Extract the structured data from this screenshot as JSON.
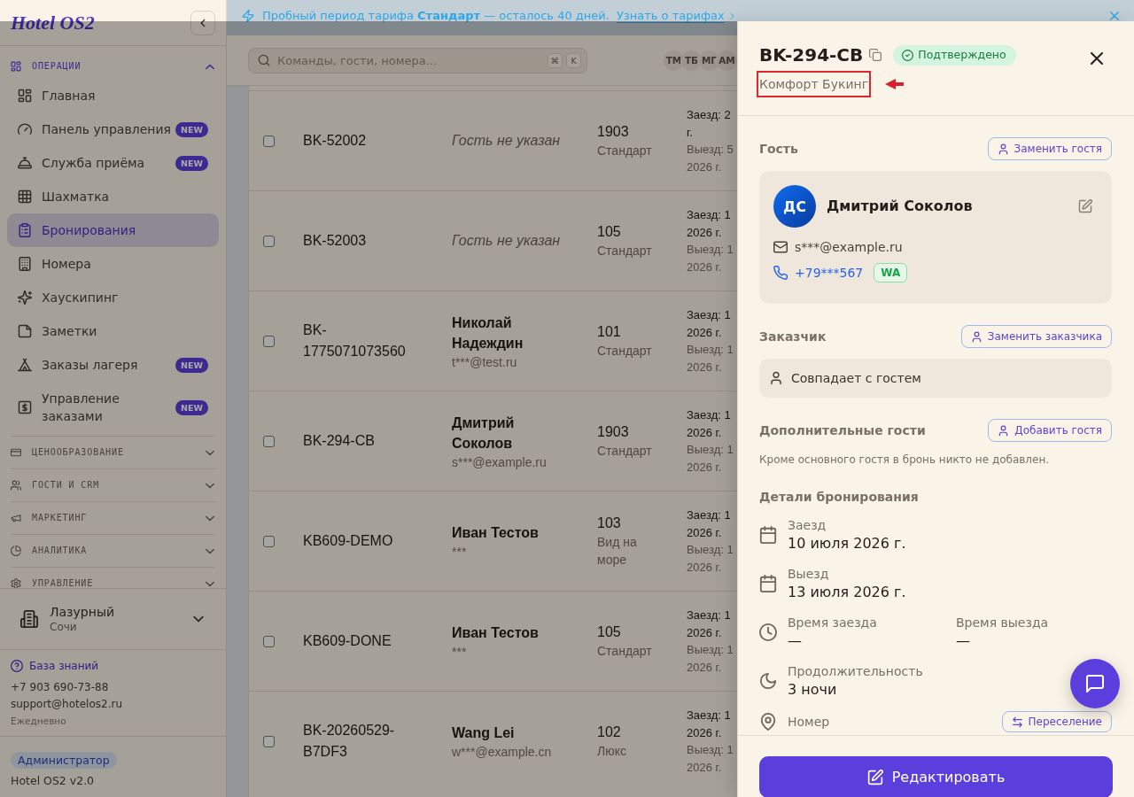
{
  "sidebar": {
    "logo": "Hotel OS2",
    "sections": [
      {
        "label": "ОПЕРАЦИИ",
        "expanded": true,
        "items": [
          {
            "label": "Главная",
            "selected": false
          },
          {
            "label": "Панель управления",
            "badge": "NEW",
            "selected": false
          },
          {
            "label": "Служба приёма",
            "badge": "NEW",
            "selected": false
          },
          {
            "label": "Шахматка",
            "selected": false
          },
          {
            "label": "Бронирования",
            "selected": true
          },
          {
            "label": "Номера",
            "selected": false
          },
          {
            "label": "Хаускипинг",
            "selected": false
          },
          {
            "label": "Заметки",
            "selected": false
          },
          {
            "label": "Заказы лагеря",
            "badge": "NEW",
            "selected": false
          },
          {
            "label": "Управление заказами",
            "badge": "NEW",
            "selected": false
          }
        ]
      },
      {
        "label": "ЦЕНООБРАЗОВАНИЕ",
        "expanded": false
      },
      {
        "label": "ГОСТИ И CRM",
        "expanded": false
      },
      {
        "label": "МАРКЕТИНГ",
        "expanded": false
      },
      {
        "label": "АНАЛИТИКА",
        "expanded": false
      },
      {
        "label": "УПРАВЛЕНИЕ",
        "expanded": false
      }
    ],
    "property": {
      "name": "Лазурный",
      "city": "Сочи"
    },
    "support": {
      "link": "База знаний",
      "phone": "+7 903 690-73-88",
      "email": "support@hotelos2.ru",
      "hours": "Ежедневно"
    },
    "user": {
      "role": "Администратор",
      "version": "Hotel OS2 v2.0"
    }
  },
  "banner": {
    "text": "Пробный период тарифа **Стандарт** — осталось 40 дней.",
    "link": "Узнать о тарифах"
  },
  "header": {
    "search": {
      "placeholder": "Команды, гости, номера...",
      "shortcut": [
        "⌘",
        "K"
      ]
    },
    "team": [
      "ТМ",
      "ТБ",
      "МГ",
      "АМ"
    ]
  },
  "bookings": {
    "rows": [
      {
        "checked": false,
        "id": "BK-52002",
        "guest": {
          "name": "Гость не указан",
          "unknown": true
        },
        "room": "1903",
        "room_type": "Стандарт",
        "checkin": [
          "Заезд: 2",
          "г."
        ],
        "checkout": [
          "Выезд: 5",
          "2026 г."
        ]
      },
      {
        "checked": false,
        "id": "BK-52003",
        "guest": {
          "name": "Гость не указан",
          "unknown": true
        },
        "room": "105",
        "room_type": "Стандарт",
        "checkin": [
          "Заезд: 1",
          "2026 г."
        ],
        "checkout": [
          "Выезд: 1",
          "2026 г."
        ]
      },
      {
        "checked": false,
        "id": "BK-1775071073560",
        "guest": {
          "name": "Николай Надеждин",
          "contact": "t***@test.ru",
          "unknown": false
        },
        "room": "101",
        "room_type": "Стандарт",
        "checkin": [
          "Заезд: 1",
          "2026 г."
        ],
        "checkout": [
          "Выезд: 1",
          "2026 г."
        ]
      },
      {
        "checked": false,
        "id": "BK-294-CB",
        "guest": {
          "name": "Дмитрий Соколов",
          "contact": "s***@example.ru",
          "unknown": false
        },
        "room": "1903",
        "room_type": "Стандарт",
        "checkin": [
          "Заезд: 1",
          "2026 г."
        ],
        "checkout": [
          "Выезд: 1",
          "2026 г."
        ]
      },
      {
        "checked": false,
        "id": "KB609-DEMO",
        "guest": {
          "name": "Иван Тестов",
          "contact": "***",
          "unknown": false
        },
        "room": "103",
        "room_type": "Вид на море",
        "checkin": [
          "Заезд: 1",
          "2026 г."
        ],
        "checkout": [
          "Выезд: 1",
          "2026 г."
        ]
      },
      {
        "checked": false,
        "id": "KB609-DONE",
        "guest": {
          "name": "Иван Тестов",
          "contact": "***",
          "unknown": false
        },
        "room": "105",
        "room_type": "Стандарт",
        "checkin": [
          "Заезд: 1",
          "2026 г."
        ],
        "checkout": [
          "Выезд: 1",
          "2026 г."
        ]
      },
      {
        "checked": false,
        "id": "BK-20260529-B7DF3",
        "guest": {
          "name": "Wang Lei",
          "contact": "w***@example.cn",
          "unknown": false
        },
        "room": "102",
        "room_type": "Люкс",
        "checkin": [
          "Заезд: 1",
          "2026 г."
        ],
        "checkout": [
          "Выезд: 1",
          "2026 г."
        ]
      }
    ]
  },
  "drawer": {
    "title": "BK-294-CB",
    "status": {
      "label": "Подтверждено",
      "kind": "confirmed"
    },
    "agency": {
      "text": "Комфорт Букинг",
      "highlighted": true
    },
    "guest": {
      "heading": "Гость",
      "action": "Заменить гостя",
      "initials": "ДС",
      "name": "Дмитрий Соколов",
      "email": "s***@example.ru",
      "phone": "+79***567",
      "messenger": "WA"
    },
    "customer": {
      "heading": "Заказчик",
      "action": "Заменить заказчика",
      "text": "Совпадает с гостем"
    },
    "extra_guests": {
      "heading": "Дополнительные гости",
      "action": "Добавить гостя",
      "note": "Кроме основного гостя в бронь никто не добавлен."
    },
    "details": {
      "heading": "Детали бронирования",
      "items": [
        {
          "kind": "date",
          "label": "Заезд",
          "value": "10 июля 2026 г."
        },
        {
          "kind": "date",
          "label": "Выезд",
          "value": "13 июля 2026 г."
        },
        {
          "kind": "times",
          "columns": [
            {
              "label": "Время заезда",
              "value": "—"
            },
            {
              "label": "Время выезда",
              "value": "—"
            }
          ]
        },
        {
          "kind": "duration",
          "label": "Продолжительность",
          "value": "3 ночи"
        },
        {
          "kind": "room",
          "label": "Номер",
          "action": "Переселение"
        }
      ]
    },
    "edit_button": "Редактировать"
  }
}
